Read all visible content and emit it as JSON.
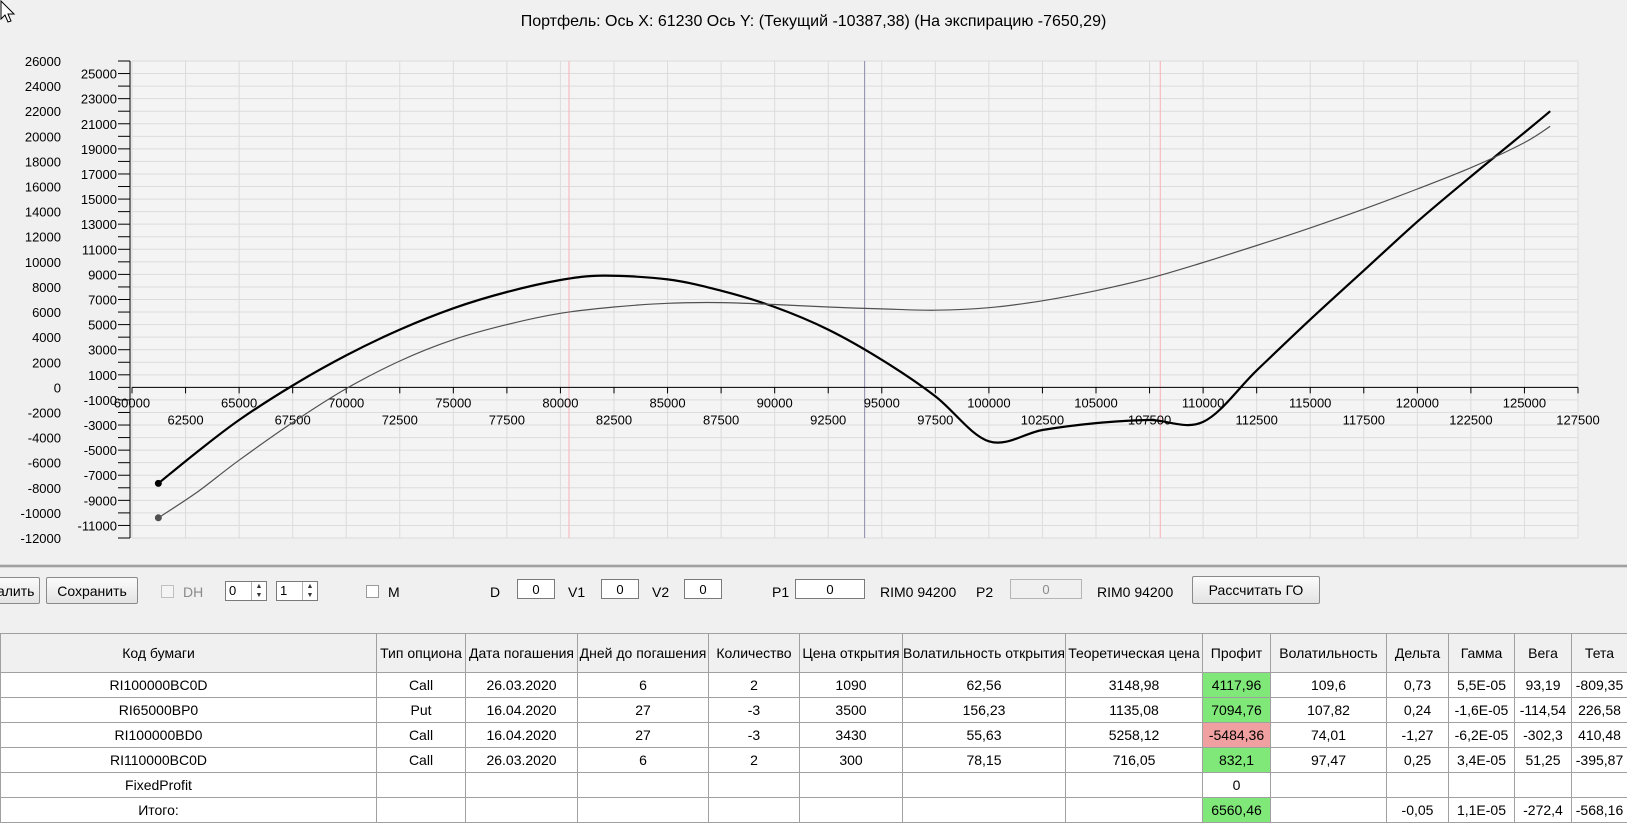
{
  "chart": {
    "title": "Портфель: Ось X: 61230 Ось Y:  (Текущий -10387,38)  (На экспирацию -7650,29)",
    "bold_yticks": [
      "26000",
      "24000",
      "22000",
      "20000",
      "18000",
      "16000",
      "14000",
      "12000",
      "10000",
      "8000",
      "6000",
      "4000",
      "2000",
      "0",
      "-2000",
      "-4000",
      "-6000",
      "-8000",
      "-10000",
      "-12000"
    ],
    "thin_yticks": [
      "25000",
      "23000",
      "21000",
      "19000",
      "17000",
      "15000",
      "13000",
      "11000",
      "9000",
      "7000",
      "5000",
      "3000",
      "1000",
      "-1000",
      "-3000",
      "-5000",
      "-7000",
      "-9000",
      "-11000"
    ],
    "xticks_upper": [
      "60000",
      "65000",
      "70000",
      "75000",
      "80000",
      "85000",
      "90000",
      "95000",
      "100000",
      "105000",
      "110000",
      "115000",
      "120000",
      "125000"
    ],
    "xticks_lower": [
      "62500",
      "67500",
      "72500",
      "77500",
      "82500",
      "87500",
      "92500",
      "97500",
      "102500",
      "107500",
      "112500",
      "117500",
      "122500",
      "127500"
    ]
  },
  "chart_data": {
    "type": "line",
    "xlim": [
      60000,
      127500
    ],
    "ylim": [
      -12000,
      26000
    ],
    "grid": true,
    "vertical_markers": {
      "pink_lines_x": [
        80400,
        108000
      ],
      "blue_line_x": 94200
    },
    "series": [
      {
        "color": "#000000",
        "points": [
          [
            61230,
            -7650
          ],
          [
            63000,
            -5200
          ],
          [
            65000,
            -2600
          ],
          [
            67500,
            150
          ],
          [
            70000,
            2550
          ],
          [
            72500,
            4600
          ],
          [
            75000,
            6300
          ],
          [
            77500,
            7600
          ],
          [
            80000,
            8550
          ],
          [
            82000,
            8900
          ],
          [
            85000,
            8600
          ],
          [
            87500,
            7700
          ],
          [
            90000,
            6400
          ],
          [
            92500,
            4600
          ],
          [
            95000,
            2200
          ],
          [
            97500,
            -700
          ],
          [
            100000,
            -4300
          ],
          [
            102500,
            -3400
          ],
          [
            105000,
            -2850
          ],
          [
            107500,
            -2600
          ],
          [
            110000,
            -2750
          ],
          [
            112500,
            1350
          ],
          [
            115000,
            5400
          ],
          [
            117500,
            9300
          ],
          [
            120000,
            13200
          ],
          [
            122500,
            16800
          ],
          [
            125000,
            20300
          ],
          [
            126200,
            22000
          ]
        ]
      },
      {
        "color": "#505050",
        "points": [
          [
            61230,
            -10390
          ],
          [
            63000,
            -8400
          ],
          [
            65000,
            -5800
          ],
          [
            67500,
            -2800
          ],
          [
            70000,
            -100
          ],
          [
            72500,
            2100
          ],
          [
            75000,
            3800
          ],
          [
            77500,
            5000
          ],
          [
            80000,
            5900
          ],
          [
            82500,
            6400
          ],
          [
            85000,
            6700
          ],
          [
            87500,
            6750
          ],
          [
            90000,
            6600
          ],
          [
            92500,
            6400
          ],
          [
            95000,
            6250
          ],
          [
            97500,
            6150
          ],
          [
            100000,
            6350
          ],
          [
            102500,
            6900
          ],
          [
            105000,
            7700
          ],
          [
            107500,
            8700
          ],
          [
            110000,
            9950
          ],
          [
            112500,
            11300
          ],
          [
            115000,
            12700
          ],
          [
            117500,
            14200
          ],
          [
            120000,
            15800
          ],
          [
            122500,
            17500
          ],
          [
            125000,
            19500
          ],
          [
            126200,
            20800
          ]
        ]
      }
    ]
  },
  "toolbar": {
    "delete_label": "Удалить",
    "save_label": "Сохранить",
    "dh_label": "DH",
    "spin1_value": "0",
    "spin2_value": "1",
    "m_label": "M",
    "d_label": "D",
    "d_value": "0",
    "v1_label": "V1",
    "v1_value": "0",
    "v2_label": "V2",
    "v2_value": "0",
    "p1_label": "P1",
    "p1_value": "0",
    "p1_instrument": "RIM0 94200",
    "p2_label": "P2",
    "p2_value": "0",
    "p2_instrument": "RIM0 94200",
    "calc_label": "Рассчитать ГО"
  },
  "table": {
    "headers": [
      "Код бумаги",
      "Тип опциона",
      "Дата погашения",
      "Дней до погашения",
      "Количество",
      "Цена открытия",
      "Волатильность открытия",
      "Теоретическая цена",
      "Профит",
      "Волатильность",
      "Дельта",
      "Гамма",
      "Вега",
      "Тета"
    ],
    "rows": [
      [
        "RI100000BC0D",
        "Call",
        "26.03.2020",
        "6",
        "2",
        "1090",
        "62,56",
        "3148,98",
        "4117,96",
        "109,6",
        "0,73",
        "5,5E-05",
        "93,19",
        "-809,35"
      ],
      [
        "RI65000BP0",
        "Put",
        "16.04.2020",
        "27",
        "-3",
        "3500",
        "156,23",
        "1135,08",
        "7094,76",
        "107,82",
        "0,24",
        "-1,6E-05",
        "-114,54",
        "226,58"
      ],
      [
        "RI100000BD0",
        "Call",
        "16.04.2020",
        "27",
        "-3",
        "3430",
        "55,63",
        "5258,12",
        "-5484,36",
        "74,01",
        "-1,27",
        "-6,2E-05",
        "-302,3",
        "410,48"
      ],
      [
        "RI110000BC0D",
        "Call",
        "26.03.2020",
        "6",
        "2",
        "300",
        "78,15",
        "716,05",
        "832,1",
        "97,47",
        "0,25",
        "3,4E-05",
        "51,25",
        "-395,87"
      ],
      [
        "FixedProfit",
        "",
        "",
        "",
        "",
        "",
        "",
        "",
        "0",
        "",
        "",
        "",
        "",
        ""
      ],
      [
        "Итого:",
        "",
        "",
        "",
        "",
        "",
        "",
        "",
        "6560,46",
        "",
        "-0,05",
        "1,1E-05",
        "-272,4",
        "-568,16"
      ]
    ]
  }
}
